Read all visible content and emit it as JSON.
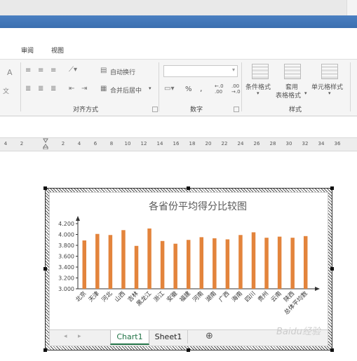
{
  "menu": {
    "tabs": [
      "审阅",
      "视图"
    ]
  },
  "ribbon": {
    "font_a": "A",
    "font_b": "文",
    "wrap_label": "自动换行",
    "merge_label": "合并后居中",
    "number_format_value": "",
    "percent": "%",
    "comma": ",",
    "inc_decimal": "←.0\n.00",
    "dec_decimal": ".00\n→.0",
    "cond_format_label": "条件格式",
    "table_format_label1": "套用",
    "table_format_label2": "表格格式",
    "cell_style_label": "单元格样式",
    "groups": [
      "对齐方式",
      "数字",
      "样式"
    ]
  },
  "ruler": {
    "ticks": [
      "4",
      "2",
      "2",
      "4",
      "6",
      "8",
      "10",
      "12",
      "14",
      "16",
      "18",
      "20",
      "22",
      "24",
      "26",
      "28",
      "30",
      "32",
      "34",
      "36"
    ]
  },
  "sheet_tabs": {
    "tabs": [
      "Chart1",
      "Sheet1"
    ],
    "active": "Chart1",
    "add_symbol": "⊕"
  },
  "watermark": "Baidu经验",
  "chart_data": {
    "type": "bar",
    "title": "各省份平均得分比较图",
    "categories": [
      "北京",
      "天津",
      "河北",
      "山西",
      "吉林",
      "黑龙江",
      "浙江",
      "安徽",
      "福建",
      "河南",
      "湖南",
      "广西",
      "海南",
      "四川",
      "贵州",
      "云南",
      "陕西",
      "总体平均数"
    ],
    "values": [
      3.89,
      4.01,
      3.99,
      4.08,
      3.79,
      4.11,
      3.88,
      3.83,
      3.9,
      3.95,
      3.93,
      3.91,
      3.99,
      4.04,
      3.94,
      3.96,
      3.94,
      3.97
    ],
    "yticks": [
      "3.000",
      "3.200",
      "3.400",
      "3.600",
      "3.800",
      "4.000",
      "4.200"
    ],
    "ylim": [
      3.0,
      4.2
    ],
    "bar_color": "#e3843c",
    "grid": false
  },
  "colors": {
    "accent": "#3b6fb0",
    "active_tab_text": "#217346"
  }
}
